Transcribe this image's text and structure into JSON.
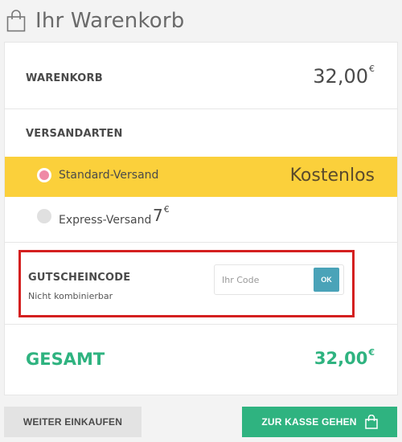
{
  "header": {
    "title": "Ihr Warenkorb",
    "icon": "shopping-bag-icon"
  },
  "subtotal": {
    "label": "WARENKORB",
    "amount": "32,00",
    "currency": "€"
  },
  "shipping": {
    "label": "VERSANDARTEN",
    "options": [
      {
        "label": "Standard-Versand",
        "price": "Kostenlos",
        "selected": true
      },
      {
        "label": "Express-Versand",
        "price": "7",
        "currency": "€",
        "selected": false
      }
    ]
  },
  "coupon": {
    "title": "GUTSCHEINCODE",
    "note": "Nicht kombinierbar",
    "placeholder": "Ihr Code",
    "value": "",
    "submit_label": "OK"
  },
  "total": {
    "label": "GESAMT",
    "amount": "32,00",
    "currency": "€"
  },
  "actions": {
    "continue_label": "WEITER EINKAUFEN",
    "checkout_label": "ZUR KASSE GEHEN",
    "checkout_icon": "shopping-bag-icon"
  },
  "colors": {
    "accent_green": "#2fb380",
    "selected_shipping_bg": "#fbd03b",
    "radio_selected": "#ef8aa6",
    "ok_button": "#4aa3b8",
    "highlight_border": "#d42020"
  }
}
